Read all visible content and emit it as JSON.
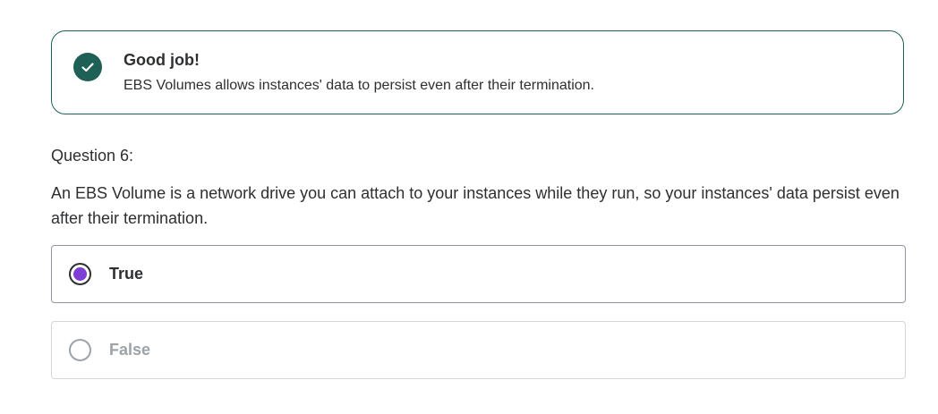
{
  "feedback": {
    "icon": "check-icon",
    "title": "Good job!",
    "message": "EBS Volumes allows instances' data to persist even after their termination.",
    "color": "#1e6055"
  },
  "question": {
    "number_label": "Question 6:",
    "text": "An EBS Volume is a network drive you can attach to your instances while they run, so your instances' data persist even after their termination."
  },
  "options": [
    {
      "label": "True",
      "selected": true
    },
    {
      "label": "False",
      "selected": false
    }
  ],
  "colors": {
    "selected_radio": "#7e3fd6",
    "disabled_text": "#9da3a7"
  }
}
